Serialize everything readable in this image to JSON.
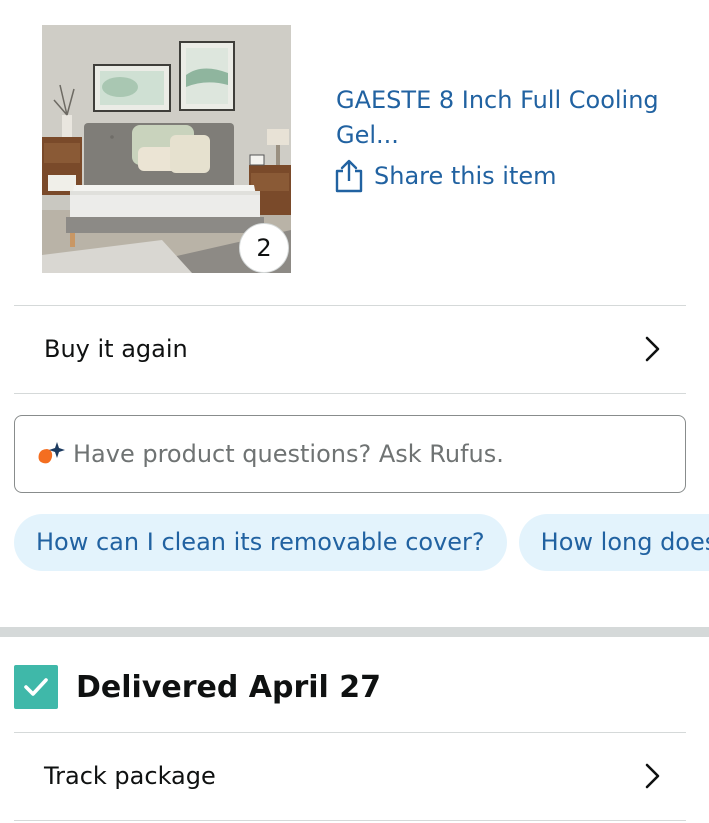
{
  "product": {
    "image_icon": "mattress-bedroom-photo",
    "quantity": "2",
    "title": "GAESTE 8 Inch Full Cooling Gel...",
    "share_label": "Share this item",
    "share_icon": "share-icon"
  },
  "actions": {
    "buy_again_label": "Buy it again",
    "track_package_label": "Track package"
  },
  "rufus": {
    "placeholder": "Have product questions? Ask Rufus.",
    "icon": "rufus-sparkle-icon"
  },
  "suggestions": [
    "How can I clean its removable cover?",
    "How long does"
  ],
  "delivery": {
    "status": "Delivered April 27",
    "check_color": "#3fb8a9"
  },
  "colors": {
    "link": "#2162a1",
    "chip_bg": "#e3f3fc",
    "divider": "#d5d9d9",
    "rufus_orange": "#f46e20",
    "rufus_blue": "#1c3b60"
  }
}
